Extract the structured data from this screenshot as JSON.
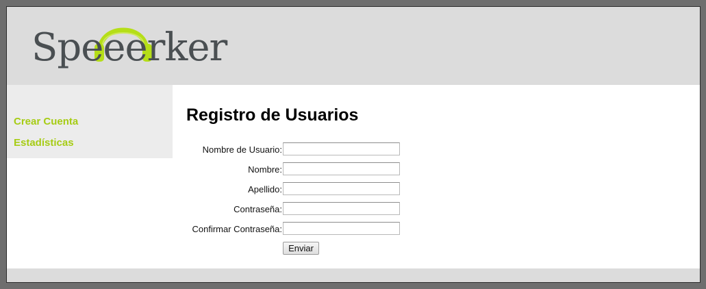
{
  "brand": {
    "logo_text": "Speeerker",
    "logo_text_color": "#4a4f52",
    "headphone_color": "#b5de18",
    "icon": "headphones-icon"
  },
  "sidebar": {
    "items": [
      {
        "label": "Crear Cuenta"
      },
      {
        "label": "Estadísticas"
      }
    ],
    "link_color": "#a6cc14"
  },
  "form": {
    "title": "Registro de Usuarios",
    "fields": [
      {
        "label": "Nombre de Usuario:",
        "value": ""
      },
      {
        "label": "Nombre:",
        "value": ""
      },
      {
        "label": "Apellido:",
        "value": ""
      },
      {
        "label": "Contraseña:",
        "value": ""
      },
      {
        "label": "Confirmar Contraseña:",
        "value": ""
      }
    ],
    "submit_label": "Enviar"
  }
}
